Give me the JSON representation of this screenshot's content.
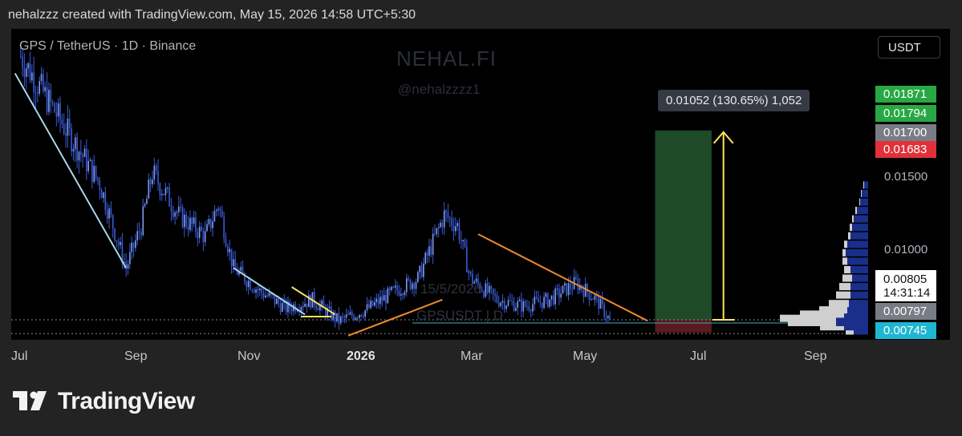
{
  "header": {
    "text": "nehalzzz created with TradingView.com, May 15, 2026 14:58 UTC+5:30"
  },
  "symbol_line": "GPS / TetherUS · 1D · Binance",
  "watermark": {
    "title": "NEHAL.FI",
    "handle": "@nehalzzzz1",
    "date": "15/5/2026",
    "symbol": "GPSUSDT | D"
  },
  "currency_button": "USDT",
  "measure_label": "0.01052 (130.65%) 1,052",
  "price_axis": {
    "ticks": [
      "0.01500",
      "0.01000"
    ],
    "badges": [
      {
        "label": "0.01871",
        "bg": "#27a844",
        "fg": "#ffffff"
      },
      {
        "label": "0.01794",
        "bg": "#27a844",
        "fg": "#ffffff"
      },
      {
        "label": "0.01700",
        "bg": "#7a7c85",
        "fg": "#ffffff"
      },
      {
        "label": "0.01683",
        "bg": "#e0313a",
        "fg": "#ffffff"
      },
      {
        "label": "0.00797",
        "bg": "#7a7c85",
        "fg": "#ffffff"
      },
      {
        "label": "0.00745",
        "bg": "#1eb6d1",
        "fg": "#ffffff"
      }
    ],
    "current_price": "0.00805",
    "countdown": "14:31:14"
  },
  "x_axis": [
    "Jul",
    "Sep",
    "Nov",
    "2026",
    "Mar",
    "May",
    "Jul",
    "Sep"
  ],
  "brand": {
    "name": "TradingView"
  },
  "colors": {
    "candle": "#3b5bd6",
    "trend_white": "#a9d6e8",
    "trend_yellow": "#f5e36a",
    "trend_orange": "#f08a2a",
    "target_zone": "#1f4a28",
    "stop_zone": "#5a1a1e",
    "arrow": "#ffe75c",
    "volume_profile_up": "#1a2f8a",
    "volume_profile_down": "#cfcfcf"
  },
  "chart_data": {
    "type": "candlestick",
    "title": "GPS / TetherUS · 1D · Binance",
    "x_range": [
      "2025-07-01",
      "2026-09-30"
    ],
    "y_range": [
      0.0068,
      0.0215
    ],
    "series": [
      {
        "values": [
          [
            "2025-07-06",
            0.0205
          ],
          [
            "2025-07-20",
            0.0185
          ],
          [
            "2025-08-03",
            0.0165
          ],
          [
            "2025-08-17",
            0.0145
          ],
          [
            "2025-08-31",
            0.0105
          ],
          [
            "2025-09-08",
            0.0125
          ],
          [
            "2025-09-14",
            0.015
          ],
          [
            "2025-09-28",
            0.013
          ],
          [
            "2025-10-12",
            0.012
          ],
          [
            "2025-10-19",
            0.0135
          ],
          [
            "2025-10-27",
            0.0105
          ],
          [
            "2025-11-10",
            0.0094
          ],
          [
            "2025-11-24",
            0.0086
          ],
          [
            "2025-12-08",
            0.009
          ],
          [
            "2025-12-22",
            0.008
          ],
          [
            "2026-01-05",
            0.0085
          ],
          [
            "2026-01-19",
            0.0093
          ],
          [
            "2026-02-02",
            0.01
          ],
          [
            "2026-02-16",
            0.013
          ],
          [
            "2026-02-23",
            0.0125
          ],
          [
            "2026-03-02",
            0.01
          ],
          [
            "2026-03-16",
            0.009
          ],
          [
            "2026-03-30",
            0.0087
          ],
          [
            "2026-04-13",
            0.009
          ],
          [
            "2026-04-27",
            0.0098
          ],
          [
            "2026-05-08",
            0.009
          ],
          [
            "2026-05-15",
            0.008
          ]
        ]
      }
    ],
    "trend_lines": [
      {
        "color": "white",
        "from": [
          "2025-07-03",
          0.0197
        ],
        "to": [
          "2025-08-31",
          0.0105
        ]
      },
      {
        "color": "white",
        "from": [
          "2025-10-27",
          0.0105
        ],
        "to": [
          "2025-12-04",
          0.0083
        ]
      },
      {
        "color": "yellow",
        "from": [
          "2025-11-27",
          0.0096
        ],
        "to": [
          "2025-12-20",
          0.0083
        ]
      },
      {
        "color": "yellow",
        "from": [
          "2025-12-02",
          0.0082
        ],
        "to": [
          "2025-12-18",
          0.0082
        ]
      },
      {
        "color": "orange",
        "from": [
          "2025-12-27",
          0.0073
        ],
        "to": [
          "2026-02-15",
          0.009
        ]
      },
      {
        "color": "orange",
        "from": [
          "2026-03-06",
          0.0121
        ],
        "to": [
          "2026-06-04",
          0.008
        ]
      }
    ],
    "measure": {
      "from_date": "2026-06-08",
      "to_date": "2026-07-08",
      "entry": 0.00805,
      "target": 0.017,
      "stop": 0.00745,
      "change": "0.01052 (130.65%) 1,052"
    }
  }
}
